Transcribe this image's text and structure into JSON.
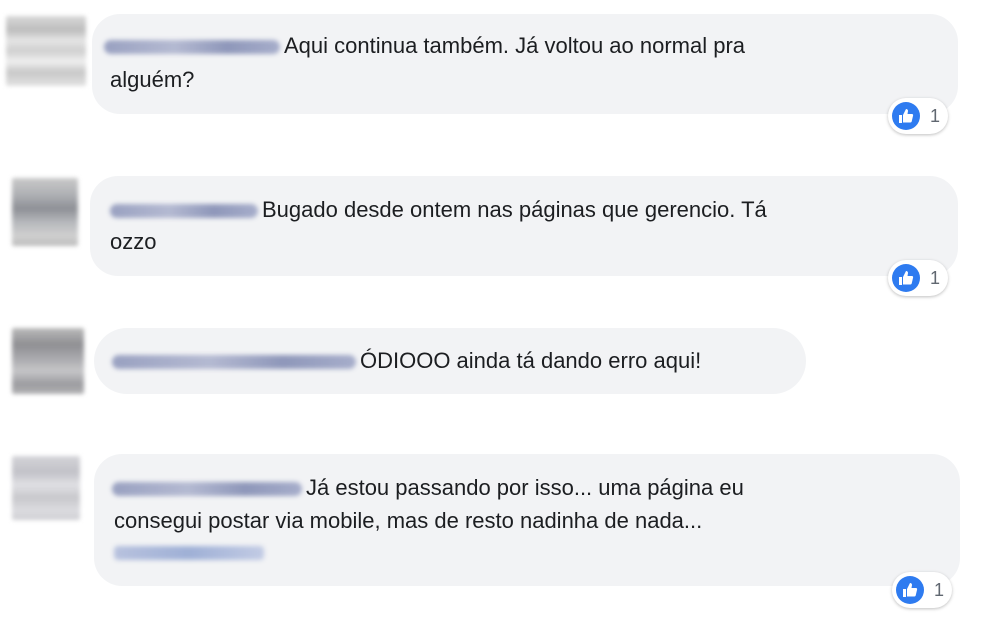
{
  "comments": [
    {
      "text_line1": "Aqui continua também. Já voltou ao normal pra",
      "text_line2": "alguém?",
      "likes": "1"
    },
    {
      "text_line1": "Bugado desde ontem nas páginas que gerencio. Tá",
      "text_line2": "ozzo",
      "likes": "1"
    },
    {
      "text_line1": "ÓDIOOO ainda tá dando erro aqui!"
    },
    {
      "text_line1": "Já estou passando por isso... uma página eu",
      "text_line2": "consegui postar via mobile, mas de resto nadinha de nada...",
      "likes": "1"
    }
  ],
  "icons": {
    "like": "thumbs-up-icon"
  },
  "colors": {
    "bubble": "#f2f3f5",
    "like_blue": "#2e7bf0",
    "text": "#1c1e21"
  }
}
